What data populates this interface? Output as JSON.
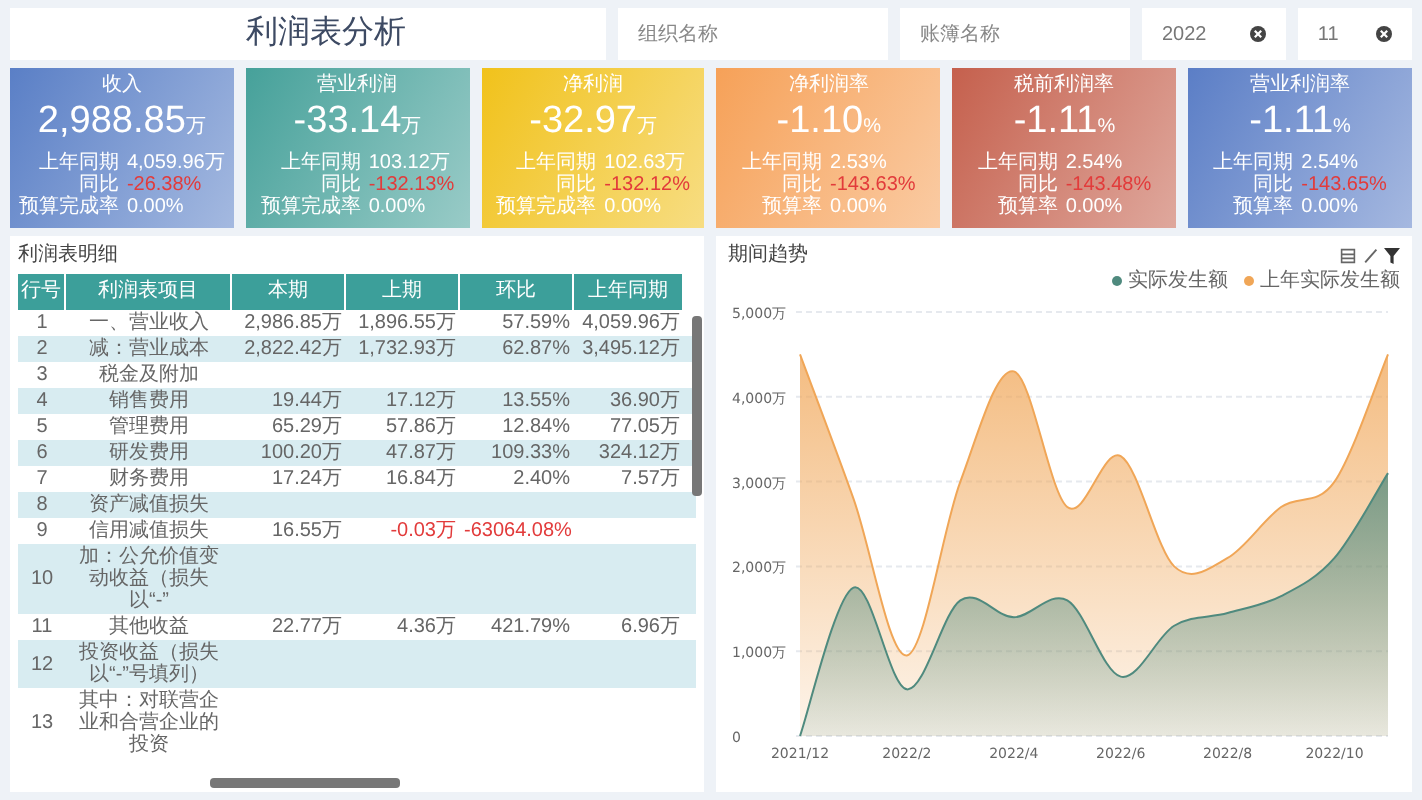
{
  "header": {
    "title": "利润表分析",
    "filters": [
      {
        "kind": "text",
        "placeholder": "组织名称"
      },
      {
        "kind": "text",
        "placeholder": "账簿名称"
      },
      {
        "kind": "select",
        "value": "2022"
      },
      {
        "kind": "select",
        "value": "11"
      }
    ]
  },
  "cards": [
    {
      "title": "收入",
      "value": "2,988.85",
      "unit": "万",
      "color": "#5a7fc6",
      "stats": [
        {
          "label": "上年同期",
          "value": "4,059.96万",
          "negative": false
        },
        {
          "label": "同比",
          "value": "-26.38%",
          "negative": true
        },
        {
          "label": "预算完成率",
          "value": "0.00%",
          "negative": false
        }
      ]
    },
    {
      "title": "营业利润",
      "value": "-33.14",
      "unit": "万",
      "color": "#46a19a",
      "stats": [
        {
          "label": "上年同期",
          "value": "103.12万",
          "negative": false
        },
        {
          "label": "同比",
          "value": "-132.13%",
          "negative": true
        },
        {
          "label": "预算完成率",
          "value": "0.00%",
          "negative": false
        }
      ]
    },
    {
      "title": "净利润",
      "value": "-32.97",
      "unit": "万",
      "color": "#f1c21b",
      "stats": [
        {
          "label": "上年同期",
          "value": "102.63万",
          "negative": false
        },
        {
          "label": "同比",
          "value": "-132.12%",
          "negative": true
        },
        {
          "label": "预算完成率",
          "value": "0.00%",
          "negative": false
        }
      ]
    },
    {
      "title": "净利润率",
      "value": "-1.10",
      "unit": "%",
      "color": "#f6a158",
      "stats": [
        {
          "label": "上年同期",
          "value": "2.53%",
          "negative": false
        },
        {
          "label": "同比",
          "value": "-143.63%",
          "negative": true
        },
        {
          "label": "预算率",
          "value": "0.00%",
          "negative": false
        }
      ]
    },
    {
      "title": "税前利润率",
      "value": "-1.11",
      "unit": "%",
      "color": "#c5604d",
      "stats": [
        {
          "label": "上年同期",
          "value": "2.54%",
          "negative": false
        },
        {
          "label": "同比",
          "value": "-143.48%",
          "negative": true
        },
        {
          "label": "预算率",
          "value": "0.00%",
          "negative": false
        }
      ]
    },
    {
      "title": "营业利润率",
      "value": "-1.11",
      "unit": "%",
      "color": "#5b7ec6",
      "stats": [
        {
          "label": "上年同期",
          "value": "2.54%",
          "negative": false
        },
        {
          "label": "同比",
          "value": "-143.65%",
          "negative": true
        },
        {
          "label": "预算率",
          "value": "0.00%",
          "negative": false
        }
      ]
    }
  ],
  "table": {
    "title": "利润表明细",
    "columns": [
      "行号",
      "利润表项目",
      "本期",
      "上期",
      "环比",
      "上年同期"
    ],
    "rows": [
      {
        "no": "1",
        "item": "一、营业收入",
        "values": [
          "2,986.85万",
          "1,896.55万",
          "57.59%",
          "4,059.96万"
        ],
        "negative": [
          false,
          false,
          false,
          false
        ]
      },
      {
        "no": "2",
        "item": "减：营业成本",
        "values": [
          "2,822.42万",
          "1,732.93万",
          "62.87%",
          "3,495.12万"
        ],
        "negative": [
          false,
          false,
          false,
          false
        ]
      },
      {
        "no": "3",
        "item": "税金及附加",
        "values": [],
        "negative": []
      },
      {
        "no": "4",
        "item": "销售费用",
        "values": [
          "19.44万",
          "17.12万",
          "13.55%",
          "36.90万"
        ],
        "negative": [
          false,
          false,
          false,
          false
        ]
      },
      {
        "no": "5",
        "item": "管理费用",
        "values": [
          "65.29万",
          "57.86万",
          "12.84%",
          "77.05万"
        ],
        "negative": [
          false,
          false,
          false,
          false
        ]
      },
      {
        "no": "6",
        "item": "研发费用",
        "values": [
          "100.20万",
          "47.87万",
          "109.33%",
          "324.12万"
        ],
        "negative": [
          false,
          false,
          false,
          false
        ]
      },
      {
        "no": "7",
        "item": "财务费用",
        "values": [
          "17.24万",
          "16.84万",
          "2.40%",
          "7.57万"
        ],
        "negative": [
          false,
          false,
          false,
          false
        ]
      },
      {
        "no": "8",
        "item": "资产减值损失",
        "values": [],
        "negative": []
      },
      {
        "no": "9",
        "item": "信用减值损失",
        "values": [
          "16.55万",
          "-0.03万",
          "-63064.08%"
        ],
        "negative": [
          false,
          true,
          true
        ]
      },
      {
        "no": "10",
        "item": "加：公允价值变动收益（损失以“-”",
        "values": [],
        "negative": []
      },
      {
        "no": "11",
        "item": "其他收益",
        "values": [
          "22.77万",
          "4.36万",
          "421.79%",
          "6.96万"
        ],
        "negative": [
          false,
          false,
          false,
          false
        ]
      },
      {
        "no": "12",
        "item": "投资收益（损失以“-”号填列）",
        "values": [],
        "negative": []
      },
      {
        "no": "13",
        "item": "其中：对联营企业和合营企业的投资",
        "values": [],
        "negative": []
      }
    ]
  },
  "trend": {
    "title": "期间趋势",
    "chart_data": {
      "type": "area",
      "grid": true,
      "categories": [
        "2021/12",
        null,
        "2022/2",
        null,
        "2022/4",
        null,
        "2022/6",
        null,
        "2022/8",
        null,
        "2022/10",
        null
      ],
      "ylim": [
        0,
        5000
      ],
      "yticks": [
        {
          "value": 0,
          "label": "0"
        },
        {
          "value": 1000,
          "label": "1,000万"
        },
        {
          "value": 2000,
          "label": "2,000万"
        },
        {
          "value": 3000,
          "label": "3,000万"
        },
        {
          "value": 4000,
          "label": "4,000万"
        },
        {
          "value": 5000,
          "label": "5,000万"
        }
      ],
      "series": [
        {
          "name": "实际发生额",
          "color": "#4f8a7e",
          "values": [
            0,
            1750,
            550,
            1600,
            1400,
            1600,
            700,
            1300,
            1450,
            1650,
            2100,
            3100
          ]
        },
        {
          "name": "上年实际发生额",
          "color": "#f0a657",
          "values": [
            4500,
            2800,
            950,
            3000,
            4300,
            2700,
            3300,
            2000,
            2100,
            2700,
            3000,
            4500
          ]
        }
      ]
    }
  }
}
